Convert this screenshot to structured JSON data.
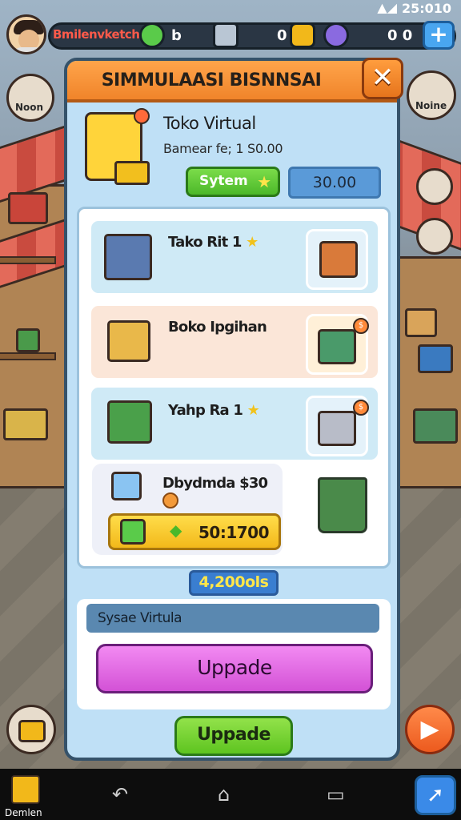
{
  "status_bar": {
    "time": "25:010",
    "icons": "▲◢"
  },
  "hud": {
    "player_name": "Bmilenvketch",
    "currency_1_value": "b",
    "currency_2_value": "0",
    "currency_3_value": "0 0",
    "plus_label": "+"
  },
  "side": {
    "left_top_label": "Noon",
    "right_top_label": "Noine"
  },
  "dialog": {
    "title": "SIMMULAASI BISNNSAI",
    "close_label": "✕",
    "shop_name": "Toko Virtual",
    "shop_sub": "Bamear fe; 1 S0.00",
    "system_button": "Sytem",
    "price": "30.00",
    "items": [
      {
        "name": "Tako Rit 1"
      },
      {
        "name": "Boko Ipgihan"
      },
      {
        "name": "Yahp Ra 1"
      }
    ],
    "special_item": {
      "name": "Dbydmda $30",
      "value": "50:1700"
    },
    "total": "4,200ols",
    "subsystem_label": "Sysae Virtula",
    "upgrade_primary": "Uppade",
    "upgrade_secondary": "Uppade"
  },
  "nav": {
    "home_label": "Demlen"
  },
  "colors": {
    "header_orange": "#f0842a",
    "upgrade_purple": "#d352d6",
    "upgrade_green": "#5ec420",
    "price_blue": "#5a9ad8"
  }
}
